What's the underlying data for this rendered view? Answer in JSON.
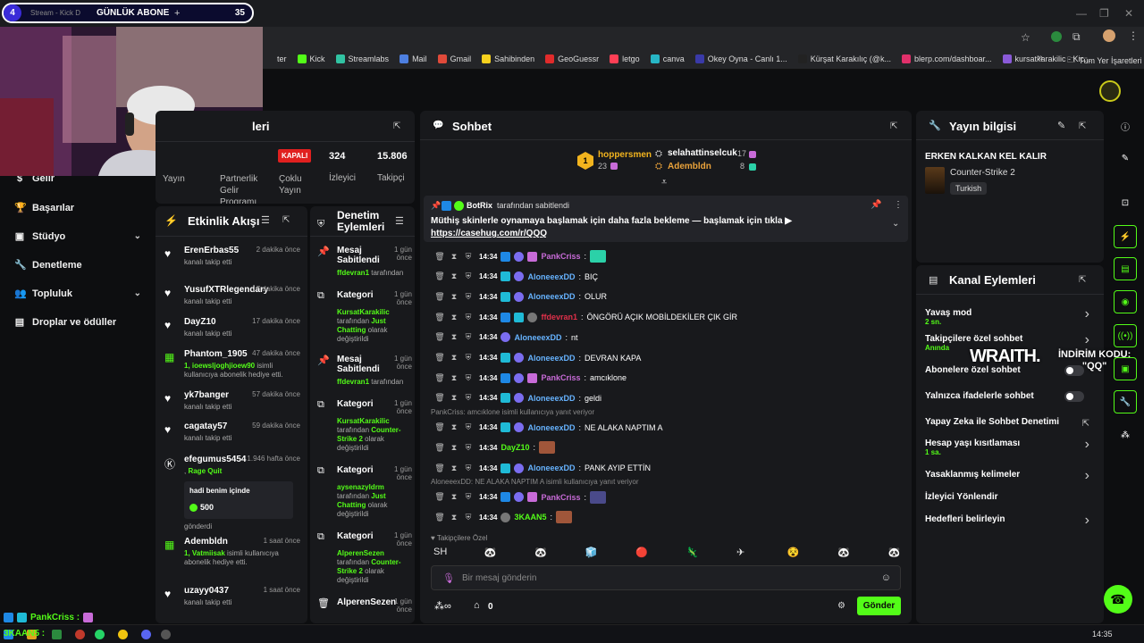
{
  "browser": {
    "tab_title": "Stream - Kick D",
    "bookmarks": [
      {
        "label": "ter",
        "color": "#00000000"
      },
      {
        "label": "Kick",
        "color": "#53fc18"
      },
      {
        "label": "Streamlabs",
        "color": "#31c3a2"
      },
      {
        "label": "Mail",
        "color": "#4d7fe0"
      },
      {
        "label": "Gmail",
        "color": "#e04a3a"
      },
      {
        "label": "Sahibinden",
        "color": "#f7d11e"
      },
      {
        "label": "GeoGuessr",
        "color": "#e02b2b"
      },
      {
        "label": "letgo",
        "color": "#ff3f55"
      },
      {
        "label": "canva",
        "color": "#27b6c6"
      },
      {
        "label": "Okey Oyna - Canlı 1...",
        "color": "#3a3aa8"
      },
      {
        "label": "Kürşat Karakılıç (@k...",
        "color": "#222222"
      },
      {
        "label": "blerp.com/dashboar...",
        "color": "#e0306a"
      },
      {
        "label": "kursatkarakilic - Kic...",
        "color": "#8a5ad8"
      }
    ],
    "all_bookmarks": "Tüm Yer İşaretleri",
    "more": "»"
  },
  "overlay": {
    "sub_count_index": "4",
    "sub_label": "GÜNLÜK ABONE",
    "sub_plus": "+",
    "sub_count": "35",
    "wraith": "WRAITH.",
    "promo_line1": "İNDİRİM KODU:",
    "promo_line2": "\"QQ\""
  },
  "nav": [
    {
      "label": "Gelir",
      "icon": "dollar-icon",
      "glyph": "$",
      "chevron": false
    },
    {
      "label": "Başarılar",
      "icon": "trophy-icon",
      "glyph": "🏆",
      "chevron": false
    },
    {
      "label": "Stüdyo",
      "icon": "studio-icon",
      "glyph": "▣",
      "chevron": true
    },
    {
      "label": "Denetleme",
      "icon": "wrench-icon",
      "glyph": "🔧",
      "chevron": false
    },
    {
      "label": "Topluluk",
      "icon": "community-icon",
      "glyph": "👥",
      "chevron": true
    },
    {
      "label": "Droplar ve ödüller",
      "icon": "drops-icon",
      "glyph": "▤",
      "chevron": false
    }
  ],
  "stats": {
    "title_partial": "leri",
    "yayin": "Yayın",
    "partnerlik": "Partnerlik Gelir Programı",
    "kapali": "KAPALI",
    "coklu_yayin": "Çoklu Yayın",
    "viewers_value": "324",
    "viewers_label": "İzleyici",
    "followers_value": "15.806",
    "followers_label": "Takipçi"
  },
  "activity": {
    "title": "Etkinlik Akışı",
    "items": [
      {
        "icon": "heart-icon",
        "glyph": "♥",
        "name": "ErenErbas55",
        "time": "2 dakika önce",
        "desc": "kanalı takip etti"
      },
      {
        "icon": "heart-icon",
        "glyph": "♥",
        "name": "YusufXTRlegendary",
        "time": "17 dakika önce",
        "desc": "kanalı takip etti"
      },
      {
        "icon": "heart-icon",
        "glyph": "♥",
        "name": "DayZ10",
        "time": "17 dakika önce",
        "desc": "kanalı takip etti"
      },
      {
        "icon": "gift-icon",
        "glyph": "▦",
        "name": "Phantom_1905",
        "time": "47 dakika önce",
        "desc_green": "1, ioewsljoghjioew90",
        "desc": " isimli kullanıcıya abonelik hediye etti."
      },
      {
        "icon": "heart-icon",
        "glyph": "♥",
        "name": "yk7banger",
        "time": "57 dakika önce",
        "desc": "kanalı takip etti"
      },
      {
        "icon": "heart-icon",
        "glyph": "♥",
        "name": "cagatay57",
        "time": "59 dakika önce",
        "desc": "kanalı takip etti"
      },
      {
        "icon": "kick-icon",
        "glyph": "Ⓚ",
        "name": "efegumus5454",
        "time": "1.946 hafta önce",
        "desc_green": "Rage Quit",
        "desc_prefix": ", ",
        "message": "hadi benim içinde",
        "amount": "500",
        "desc_after": "gönderdi"
      },
      {
        "icon": "gift-icon",
        "glyph": "▦",
        "name": "Adembldn",
        "time": "1 saat önce",
        "desc_green": "1, Vatmiisak",
        "desc": " isimli kullanıcıya abonelik hediye etti."
      },
      {
        "icon": "heart-icon",
        "glyph": "♥",
        "name": "uzayy0437",
        "time": "1 saat önce",
        "desc": "kanalı takip etti"
      }
    ]
  },
  "modlog": {
    "title": "Denetim Eylemleri",
    "items": [
      {
        "icon": "pin-icon",
        "glyph": "📌",
        "title": "Mesaj Sabitlendi",
        "time": "1 gün önce",
        "actor": "ffdevran1",
        "desc": " tarafından"
      },
      {
        "icon": "category-icon",
        "glyph": "⧉",
        "title": "Kategori",
        "time": "1 gün önce",
        "actor": "KursatKarakilic",
        "desc": " tarafından ",
        "value": "Just Chatting",
        "desc2": " olarak değiştirildi"
      },
      {
        "icon": "pin-icon",
        "glyph": "📌",
        "title": "Mesaj Sabitlendi",
        "time": "1 gün önce",
        "actor": "ffdevran1",
        "desc": " tarafından"
      },
      {
        "icon": "category-icon",
        "glyph": "⧉",
        "title": "Kategori",
        "time": "1 gün önce",
        "actor": "KursatKarakilic",
        "desc": " tarafından ",
        "value": "Counter-Strike 2",
        "desc2": " olarak değiştirildi"
      },
      {
        "icon": "category-icon",
        "glyph": "⧉",
        "title": "Kategori",
        "time": "1 gün önce",
        "actor": "aysenazyldrm",
        "desc": " tarafından ",
        "value": "Just Chatting",
        "desc2": " olarak değiştirildi"
      },
      {
        "icon": "category-icon",
        "glyph": "⧉",
        "title": "Kategori",
        "time": "1 gün önce",
        "actor": "AlperenSezen",
        "desc": " tarafından ",
        "value": "Counter-Strike 2",
        "desc2": " olarak değiştirildi"
      },
      {
        "icon": "trash-icon",
        "glyph": "🗑",
        "title": "AlperenSezen",
        "time": "1 gün önce"
      }
    ]
  },
  "chat": {
    "title": "Sohbet",
    "top_gifters": [
      {
        "rank": "1",
        "name": "hoppersmen",
        "count": "23"
      },
      {
        "name": "selahattinselcuk",
        "count": "17"
      },
      {
        "name": "Adembldn",
        "count": "8"
      }
    ],
    "pinned": {
      "by": "BotRix",
      "by_suffix": "tarafından sabitlendi",
      "text": "Müthiş skinlerle oynamaya başlamak için daha fazla bekleme — başlamak için tıkla ▶",
      "link": "https://casehug.com/r/QQQ"
    },
    "messages": [
      {
        "time": "14:34",
        "user": "PankCriss",
        "ucolor": "#c86bd8",
        "text": "",
        "emote": "#2bd1a8",
        "badges": [
          "b-blue",
          "b-lil",
          "b-pink"
        ]
      },
      {
        "time": "14:34",
        "user": "AloneeexDD",
        "ucolor": "#66b3ff",
        "text": "BIÇ",
        "badges": [
          "b-cyan",
          "b-lil"
        ]
      },
      {
        "time": "14:34",
        "user": "AloneeexDD",
        "ucolor": "#66b3ff",
        "text": "OLUR",
        "badges": [
          "b-cyan",
          "b-lil"
        ]
      },
      {
        "time": "14:34",
        "user": "ffdevran1",
        "ucolor": "#e0304a",
        "text": "ÖNGÖRÜ AÇIK MOBİLDEKİLER ÇIK GİR",
        "badges": [
          "b-blue",
          "b-cyan",
          "b-gray"
        ]
      },
      {
        "time": "14:34",
        "user": "AloneeexDD",
        "ucolor": "#66b3ff",
        "text": "nt",
        "badges": [
          "b-lil"
        ]
      },
      {
        "time": "14:34",
        "user": "AloneeexDD",
        "ucolor": "#66b3ff",
        "text": "DEVRAN KAPA",
        "badges": [
          "b-cyan",
          "b-lil"
        ]
      },
      {
        "time": "14:34",
        "user": "PankCriss",
        "ucolor": "#c86bd8",
        "text": "amcıklone",
        "badges": [
          "b-blue",
          "b-lil",
          "b-pink"
        ]
      },
      {
        "time": "14:34",
        "user": "AloneeexDD",
        "ucolor": "#66b3ff",
        "text": "geldi",
        "badges": [
          "b-cyan",
          "b-lil"
        ]
      },
      {
        "reply": "PankCriss: amcıklone isimli kullanıcıya yanıt veriyor"
      },
      {
        "time": "14:34",
        "user": "AloneeexDD",
        "ucolor": "#66b3ff",
        "text": "NE ALAKA NAPTIM A",
        "badges": [
          "b-cyan",
          "b-lil"
        ]
      },
      {
        "time": "14:34",
        "user": "DayZ10",
        "ucolor": "#53fc18",
        "text": "",
        "emote": "#a0563a",
        "badges": []
      },
      {
        "time": "14:34",
        "user": "AloneeexDD",
        "ucolor": "#66b3ff",
        "text": "PANK AYIP ETTİN",
        "badges": [
          "b-cyan",
          "b-lil"
        ]
      },
      {
        "reply": "AloneeexDD: NE ALAKA NAPTIM A isimli kullanıcıya yanıt veriyor"
      },
      {
        "time": "14:34",
        "user": "PankCriss",
        "ucolor": "#c86bd8",
        "text": "",
        "emote": "#4a4a8a",
        "badges": [
          "b-blue",
          "b-lil",
          "b-pink"
        ]
      },
      {
        "time": "14:34",
        "user": "3KAAN5",
        "ucolor": "#53fc18",
        "text": "",
        "emote": "#a0563a",
        "badges": [
          "b-gray"
        ]
      }
    ],
    "followers_only": "Takipçilere Özel",
    "emotes": [
      "SH",
      "🐼",
      "🐼",
      "🧊",
      "🔴",
      "🦎",
      "✈",
      "😵",
      "🐼",
      "🐼"
    ],
    "input_placeholder": "Bir mesaj gönderin",
    "points": "0",
    "send_label": "Gönder"
  },
  "stream_info": {
    "title": "Yayın bilgisi",
    "stream_title": "ERKEN KALKAN KEL KALIR",
    "game": "Counter-Strike 2",
    "language": "Turkish"
  },
  "channel_actions": {
    "title": "Kanal Eylemleri",
    "items": [
      {
        "label": "Yavaş mod",
        "sub": "2 sn.",
        "control": "chevron"
      },
      {
        "label": "Takipçilere özel sohbet",
        "sub": "Anında",
        "control": "chevron"
      },
      {
        "label": "Abonelere özel sohbet",
        "control": "toggle"
      },
      {
        "label": "Yalnızca ifadelerle sohbet",
        "control": "toggle"
      },
      {
        "label": "Yapay Zeka ile Sohbet Denetimi",
        "control": "external"
      },
      {
        "label": "Hesap yaşı kısıtlaması",
        "sub": "1 sa.",
        "control": "chevron"
      },
      {
        "label": "Yasaklanmış kelimeler",
        "control": "chevron"
      },
      {
        "label": "İzleyici Yönlendir",
        "control": "none"
      },
      {
        "label": "Hedefleri belirleyin",
        "control": "chevron"
      }
    ]
  },
  "taskbar": {
    "chat_preview_user": "PankCriss :",
    "chat_preview_user2": "3KAAN5 :",
    "clock": "14:35"
  },
  "colors": {
    "accent": "#53fc18",
    "panel": "#18191c",
    "bg": "#0d0e10"
  }
}
